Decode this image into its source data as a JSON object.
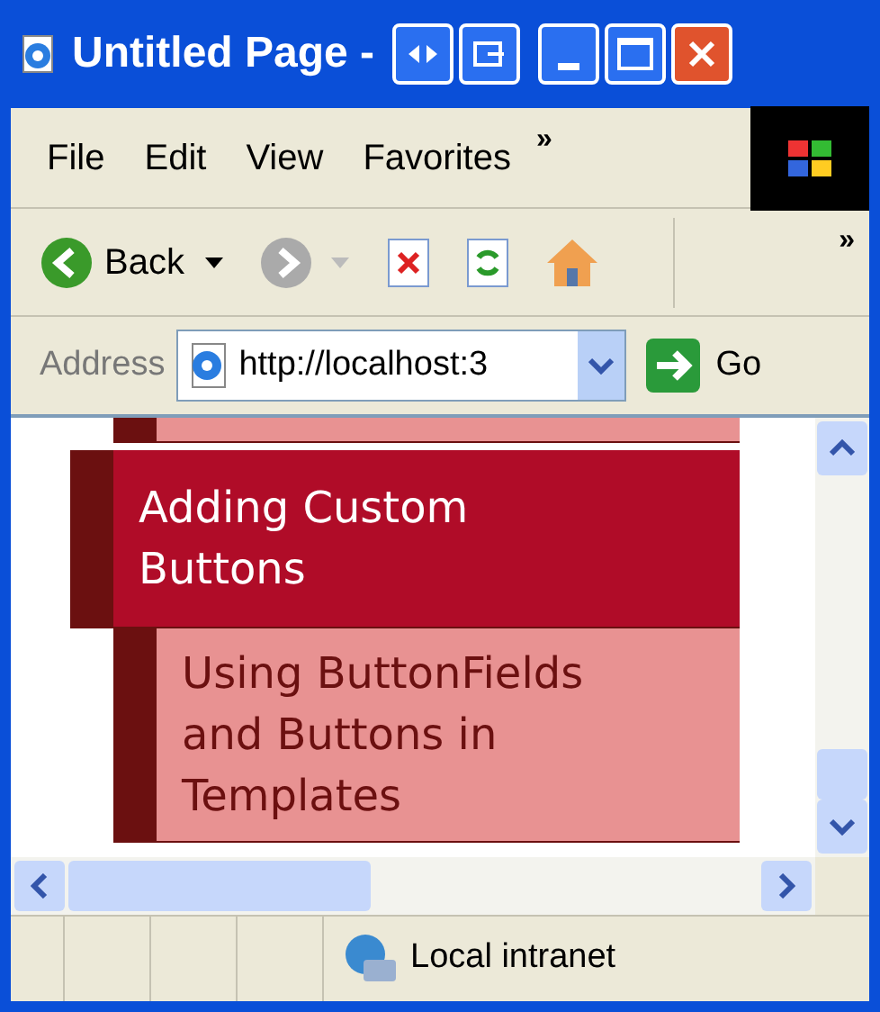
{
  "window": {
    "title": "Untitled Page -"
  },
  "menu_bar": {
    "items": [
      {
        "label": "File"
      },
      {
        "label": "Edit"
      },
      {
        "label": "View"
      },
      {
        "label": "Favorites"
      }
    ],
    "overflow": "»"
  },
  "toolbar": {
    "back": "Back",
    "overflow": "»"
  },
  "address_bar": {
    "label": "Address",
    "value": "http://localhost:3",
    "go": "Go"
  },
  "content": {
    "menu": [
      {
        "label": "Adding Custom Buttons",
        "selected": true,
        "children": [
          {
            "label": "Using ButtonFields and Buttons in Templates",
            "selected": false
          }
        ]
      }
    ]
  },
  "status_bar": {
    "zone": "Local intranet"
  }
}
